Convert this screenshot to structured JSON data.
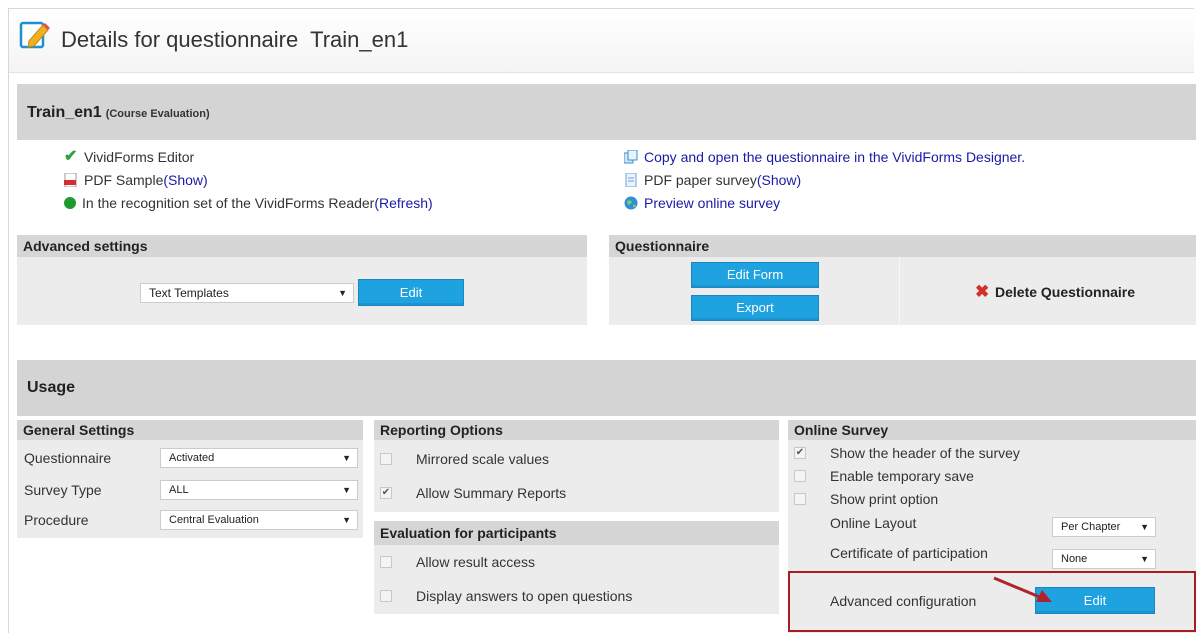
{
  "header": {
    "title": "Details for questionnaire  Train_en1"
  },
  "summary": {
    "name": "Train_en1",
    "type": "(Course Evaluation)",
    "left_items": [
      {
        "text": "VividForms Editor",
        "link": ""
      },
      {
        "text": "PDF Sample ",
        "link": "(Show)"
      },
      {
        "text": "In the recognition set of the VividForms Reader ",
        "link": "(Refresh)"
      }
    ],
    "right_items": [
      {
        "text": "",
        "link": "Copy and open the questionnaire in the VividForms Designer."
      },
      {
        "text": "PDF paper survey ",
        "link": "(Show)"
      },
      {
        "text": "",
        "link": "Preview online survey"
      }
    ]
  },
  "advanced_settings": {
    "title": "Advanced settings",
    "select_value": "Text Templates",
    "edit_label": "Edit"
  },
  "questionnaire": {
    "title": "Questionnaire",
    "edit_form_label": "Edit Form",
    "export_label": "Export",
    "delete_label": "Delete Questionnaire"
  },
  "usage": {
    "title": "Usage",
    "general": {
      "title": "General Settings",
      "rows": [
        {
          "label": "Questionnaire",
          "value": "Activated"
        },
        {
          "label": "Survey Type",
          "value": "ALL"
        },
        {
          "label": "Procedure",
          "value": "Central Evaluation"
        }
      ]
    },
    "reporting": {
      "title": "Reporting Options",
      "items": [
        {
          "label": "Mirrored scale values",
          "checked": false
        },
        {
          "label": "Allow Summary Reports",
          "checked": true
        }
      ]
    },
    "evaluation": {
      "title": "Evaluation for participants",
      "items": [
        {
          "label": "Allow result access",
          "checked": false
        },
        {
          "label": "Display answers to open questions",
          "checked": false
        }
      ]
    },
    "online": {
      "title": "Online Survey",
      "items": [
        {
          "label": "Show the header of the survey",
          "checked": true
        },
        {
          "label": "Enable temporary save",
          "checked": false
        },
        {
          "label": "Show print option",
          "checked": false
        }
      ],
      "layout_label": "Online Layout",
      "layout_value": "Per Chapter",
      "certificate_label": "Certificate of participation",
      "certificate_value": "None",
      "advanced_label": "Advanced configuration",
      "advanced_edit_label": "Edit"
    }
  },
  "colors": {
    "accent": "#1fa2e0",
    "highlight": "#a71d22",
    "link": "#1a1aa6"
  }
}
